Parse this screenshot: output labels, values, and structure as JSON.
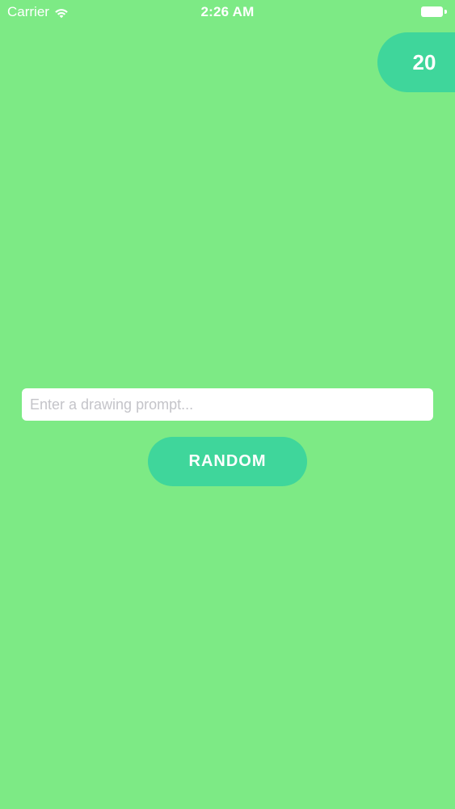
{
  "status_bar": {
    "carrier": "Carrier",
    "time": "2:26 AM",
    "wifi_icon": "wifi-icon",
    "battery_icon": "battery-icon"
  },
  "counter": {
    "value": "20"
  },
  "prompt": {
    "placeholder": "Enter a drawing prompt...",
    "value": ""
  },
  "random_button": {
    "label": "RANDOM"
  },
  "colors": {
    "background": "#7dea85",
    "accent": "#3fd69b",
    "text_on_accent": "#ffffff"
  }
}
